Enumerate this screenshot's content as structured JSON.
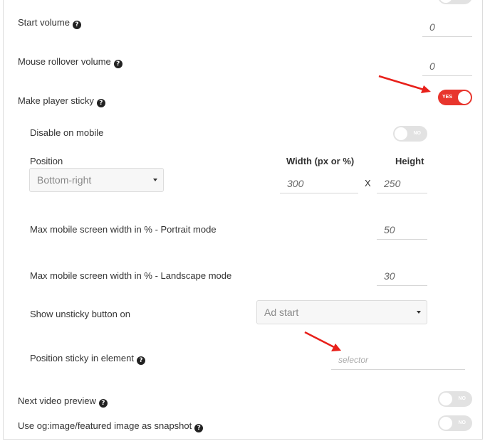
{
  "settings": {
    "start_volume": {
      "label": "Start volume",
      "value": "0"
    },
    "mouse_rollover_volume": {
      "label": "Mouse rollover volume",
      "value": "0"
    },
    "make_player_sticky": {
      "label": "Make player sticky",
      "state": "YES"
    },
    "disable_on_mobile": {
      "label": "Disable on mobile",
      "state": "NO"
    },
    "position": {
      "label": "Position",
      "selected": "Bottom-right"
    },
    "width": {
      "label": "Width (px or %)",
      "value": "300"
    },
    "height": {
      "label": "Height",
      "value": "250"
    },
    "separator": "X",
    "max_portrait": {
      "label": "Max mobile screen width in % - Portrait mode",
      "value": "50"
    },
    "max_landscape": {
      "label": "Max mobile screen width in % - Landscape mode",
      "value": "30"
    },
    "unsticky": {
      "label": "Show unsticky button on",
      "selected": "Ad start"
    },
    "sticky_element": {
      "label": "Position sticky in element",
      "placeholder": "selector"
    },
    "next_video_preview": {
      "label": "Next video preview",
      "state": "NO"
    },
    "og_image": {
      "label": "Use og:image/featured image as snapshot",
      "state": "NO"
    }
  },
  "help_glyph": "?",
  "colors": {
    "accent": "#e8352d",
    "toggle_off": "#e2e2e2",
    "arrow": "#e8201a"
  }
}
